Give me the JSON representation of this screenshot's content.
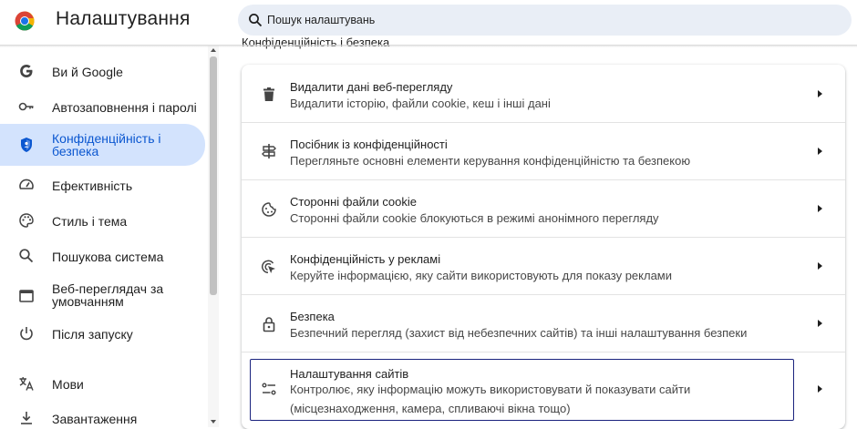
{
  "header": {
    "title": "Налаштування",
    "search_placeholder": "Пошук налаштувань"
  },
  "sidebar": {
    "items": [
      {
        "label": "Ви й Google",
        "icon": "google-g-icon"
      },
      {
        "label": "Автозаповнення і паролі",
        "icon": "key-icon"
      },
      {
        "label": "Конфіденційність і безпека",
        "icon": "shield-icon",
        "active": true
      },
      {
        "label": "Ефективність",
        "icon": "speedometer-icon"
      },
      {
        "label": "Стиль і тема",
        "icon": "palette-icon"
      },
      {
        "label": "Пошукова система",
        "icon": "search-icon"
      },
      {
        "label": "Веб-переглядач за умовчанням",
        "icon": "browser-window-icon"
      },
      {
        "label": "Після запуску",
        "icon": "power-icon"
      },
      {
        "label": "Мови",
        "icon": "translate-icon"
      },
      {
        "label": "Завантаження",
        "icon": "download-icon"
      }
    ]
  },
  "main": {
    "section_title": "Конфіденційність і безпека",
    "rows": [
      {
        "title": "Видалити дані веб-перегляду",
        "subtitle": "Видалити історію, файли cookie, кеш і інші дані",
        "icon": "trash-icon"
      },
      {
        "title": "Посібник із конфіденційності",
        "subtitle": "Перегляньте основні елементи керування конфіденційністю та безпекою",
        "icon": "signpost-icon"
      },
      {
        "title": "Сторонні файли cookie",
        "subtitle": "Сторонні файли cookie блокуються в режимі анонімного перегляду",
        "icon": "cookie-icon"
      },
      {
        "title": "Конфіденційність у рекламі",
        "subtitle": "Керуйте інформацією, яку сайти використовують для показу реклами",
        "icon": "ad-privacy-icon"
      },
      {
        "title": "Безпека",
        "subtitle": "Безпечний перегляд (захист від небезпечних сайтів) та інші налаштування безпеки",
        "icon": "lock-icon"
      },
      {
        "title": "Налаштування сайтів",
        "subtitle": "Контролює, яку інформацію можуть використовувати й показувати сайти (місцезнаходження, камера, спливаючі вікна тощо)",
        "icon": "tune-icon"
      }
    ]
  },
  "colors": {
    "accent": "#0b57d0",
    "active_bg": "#d3e3fd",
    "search_bg": "#e9eef6",
    "highlight_border": "#1a237e"
  }
}
